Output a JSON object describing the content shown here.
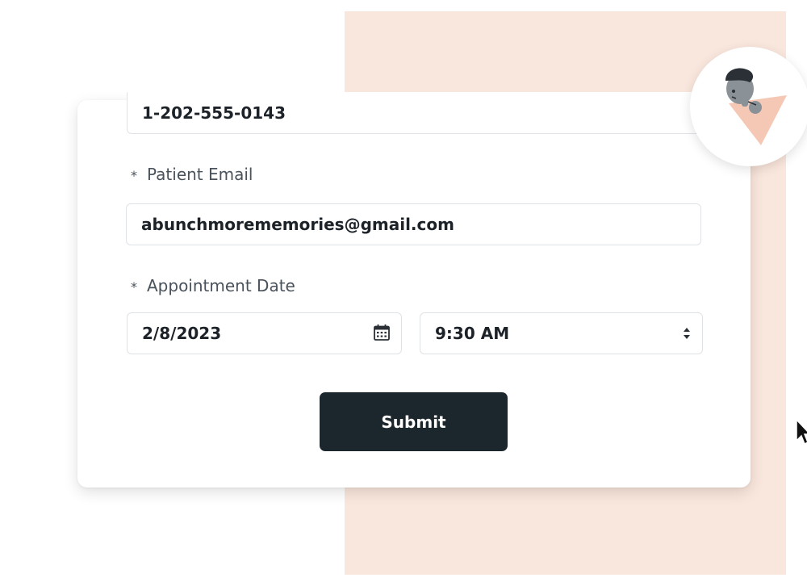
{
  "form": {
    "phone": {
      "value": "1-202-555-0143"
    },
    "email": {
      "required_marker": "*",
      "label": "Patient Email",
      "value": "abunchmorememories@gmail.com"
    },
    "appointment": {
      "required_marker": "*",
      "label": "Appointment Date",
      "date_value": "2/8/2023",
      "time_value": "9:30 AM"
    },
    "submit_label": "Submit"
  },
  "icons": {
    "calendar": "calendar-icon",
    "time_select": "select-arrows-icon",
    "avatar": "person-illustration-icon",
    "cursor": "mouse-pointer-icon"
  },
  "colors": {
    "peach_background": "#f9e6dc",
    "button_background": "#1c262d",
    "label_text": "#4a525b",
    "field_text": "#1c2228",
    "field_border": "#dfe2e6"
  }
}
